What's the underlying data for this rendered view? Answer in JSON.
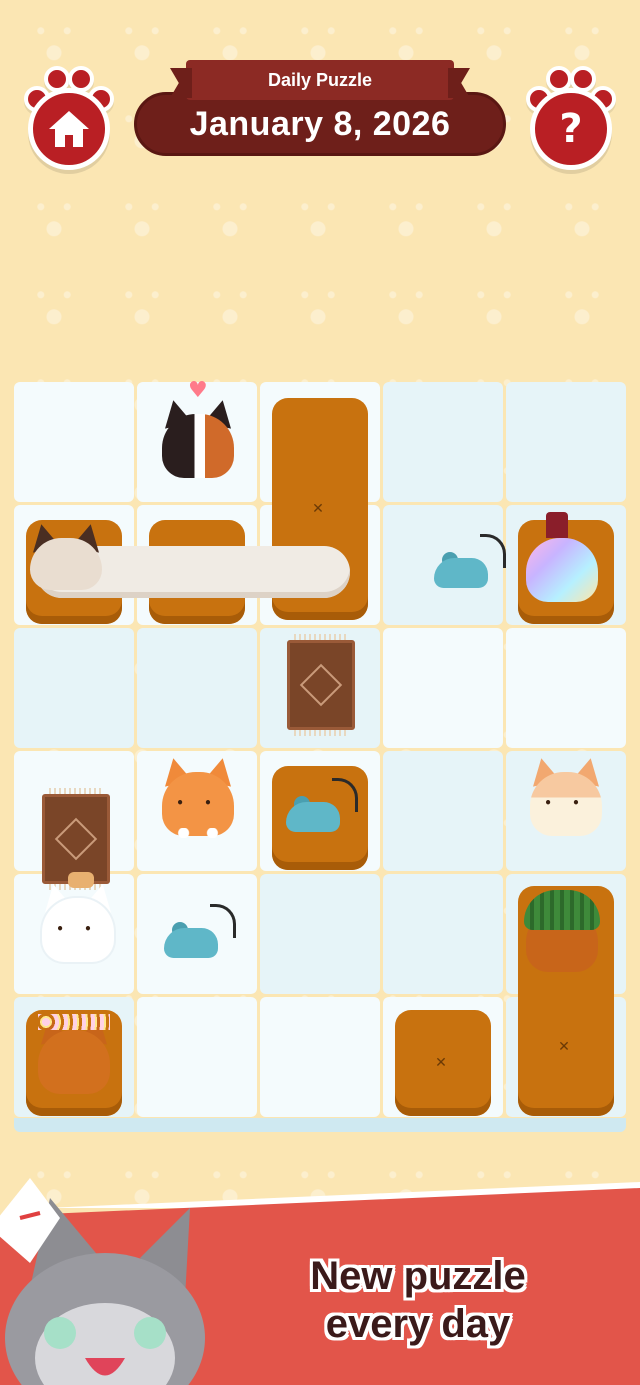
{
  "header": {
    "ribbon_label": "Daily Puzzle",
    "date": "January 8, 2026"
  },
  "buttons": {
    "home_icon": "home-icon",
    "help_glyph": "?"
  },
  "board": {
    "columns": 5,
    "rows": 6,
    "cats": [
      "calico-cat",
      "siamese-cat",
      "rainbow-cat",
      "orange-tabby-cat",
      "cream-cat",
      "white-cat",
      "watermelon-hat-cat",
      "flower-crown-cat"
    ],
    "mice": 3,
    "rugs": 2
  },
  "promo": {
    "line1": "New puzzle",
    "line2": "every day"
  },
  "colors": {
    "background": "#fbe6b3",
    "button_red": "#b91f24",
    "ribbon": "#8c2a24",
    "cushion": "#c8720f",
    "mouse": "#5fb7c8",
    "banner": "#e2554a"
  }
}
